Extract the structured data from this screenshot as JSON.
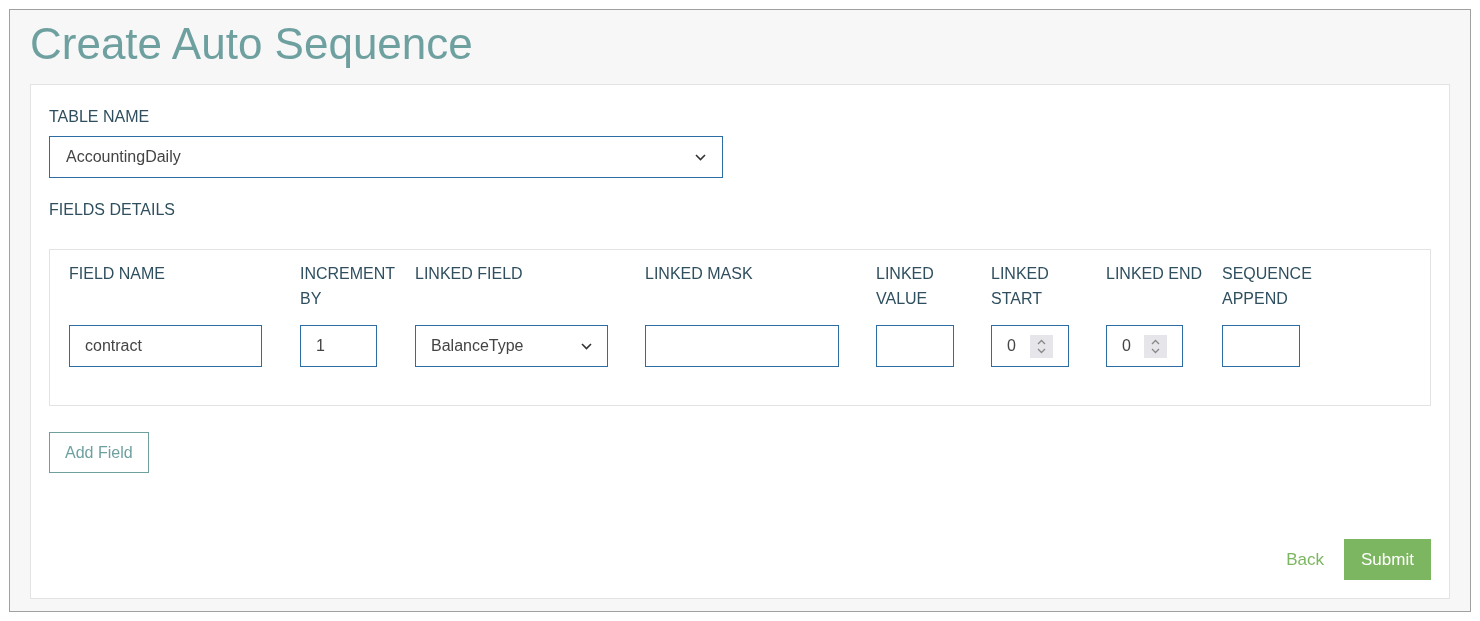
{
  "title": "Create Auto Sequence",
  "table_name": {
    "label": "TABLE NAME",
    "value": "AccountingDaily"
  },
  "fields_details": {
    "label": "FIELDS DETAILS",
    "columns": [
      {
        "label": "FIELD NAME",
        "kind": "text",
        "value": "contract"
      },
      {
        "label": "INCREMENT BY",
        "kind": "text",
        "value": "1"
      },
      {
        "label": "LINKED FIELD",
        "kind": "select",
        "value": "BalanceType"
      },
      {
        "label": "LINKED MASK",
        "kind": "text"
      },
      {
        "label": "LINKED VALUE",
        "kind": "text"
      },
      {
        "label": "LINKED START",
        "kind": "spinner",
        "value": "0"
      },
      {
        "label": "LINKED END",
        "kind": "spinner",
        "value": "0"
      },
      {
        "label": "SEQUENCE APPEND",
        "kind": "text"
      }
    ]
  },
  "add_button": "Add Field",
  "back_link": "Back",
  "submit_button": "Submit"
}
